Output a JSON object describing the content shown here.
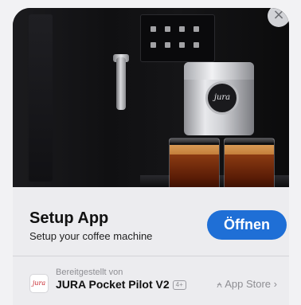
{
  "banner": {
    "hero_image": "coffee-machine-photo",
    "close_glyph": "×",
    "logo_text": "jura"
  },
  "app": {
    "title": "Setup App",
    "subtitle": "Setup your coffee machine",
    "open_label": "Öffnen",
    "provided_by_label": "Bereitgestellt von",
    "name": "JURA Pocket Pilot V2",
    "age_rating": "4+",
    "store_label": "App Store",
    "store_chevron": "›",
    "store_icon": "app-store-icon"
  },
  "colors": {
    "accent": "#1f6fd6",
    "brand_red": "#c6262d"
  }
}
